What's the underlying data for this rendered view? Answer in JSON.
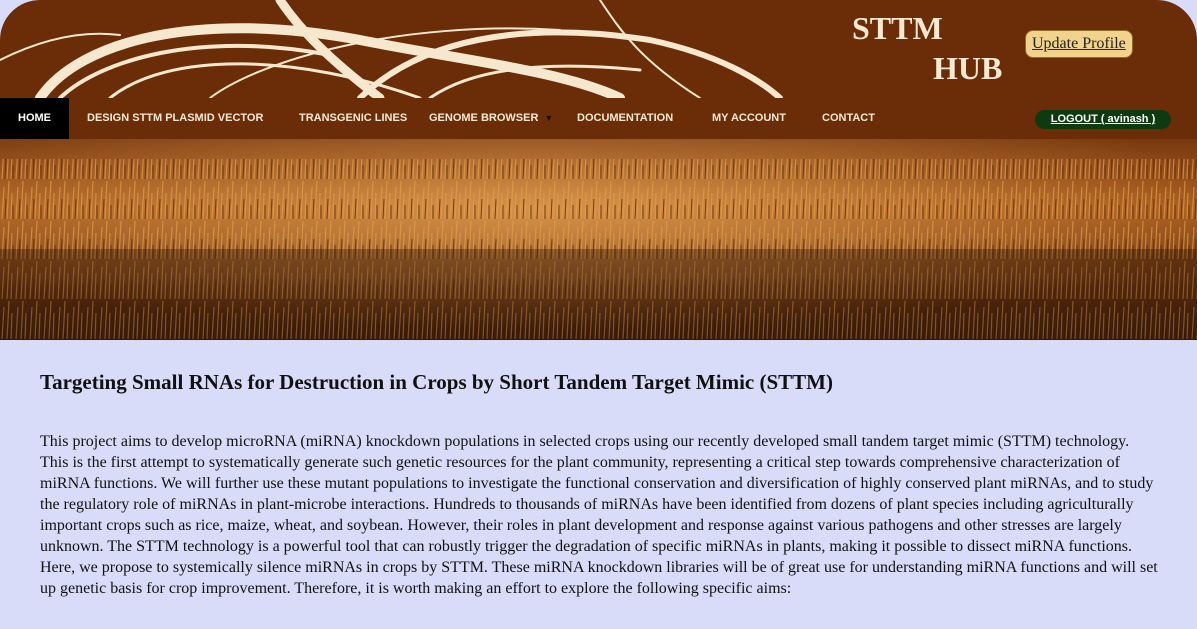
{
  "header": {
    "logo_line1": "STTM",
    "logo_line2": "HUB",
    "update_profile_label": "Update Profile"
  },
  "nav": {
    "items": [
      {
        "label": "HOME"
      },
      {
        "label": "DESIGN STTM PLASMID VECTOR"
      },
      {
        "label": "TRANSGENIC LINES"
      },
      {
        "label": "GENOME BROWSER"
      },
      {
        "label": "DOCUMENTATION"
      },
      {
        "label": "MY ACCOUNT"
      },
      {
        "label": "CONTACT"
      }
    ],
    "dropdown_arrow": "▼",
    "logout_label": "LOGOUT ( avinash )"
  },
  "main": {
    "title": "Targeting Small RNAs for Destruction in Crops by Short Tandem Target Mimic (STTM)",
    "paragraph": "This project aims to develop microRNA (miRNA) knockdown populations in selected crops using our recently developed small tandem target mimic (STTM) technology. This is the first attempt to systematically generate such genetic resources for the plant community, representing a critical step towards comprehensive characterization of miRNA functions. We will further use these mutant populations to investigate the functional conservation and diversification of highly conserved plant miRNAs, and to study the regulatory role of miRNAs in plant-microbe interactions. Hundreds to thousands of miRNAs have been identified from dozens of plant species including agriculturally important crops such as rice, maize, wheat, and soybean. However, their roles in plant development and response against various pathogens and other stresses are largely unknown. The STTM technology is a powerful tool that can robustly trigger the degradation of specific miRNAs in plants, making it possible to dissect miRNA functions. Here, we propose to systemically silence miRNAs in crops by STTM. These miRNA knockdown libraries will be of great use for understanding miRNA functions and will set up genetic basis for crop improvement. Therefore, it is worth making an effort to explore the following specific aims:"
  },
  "colors": {
    "header_brown": "#6b2d07",
    "page_background": "#d9dcf9",
    "logout_green": "#0e3a10",
    "update_button": "#f1d38b"
  }
}
